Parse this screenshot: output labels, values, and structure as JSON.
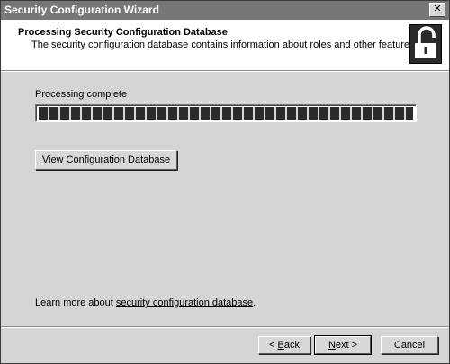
{
  "window": {
    "title": "Security Configuration Wizard",
    "close_glyph": "✕"
  },
  "header": {
    "title": "Processing Security Configuration Database",
    "subtitle": "The security configuration database contains information about roles and other features."
  },
  "progress": {
    "label": "Processing complete",
    "percent": 100
  },
  "view_button": {
    "mnemonic": "V",
    "rest": "iew Configuration Database"
  },
  "learn_more": {
    "prefix": "Learn more about ",
    "link": "security configuration database",
    "suffix": "."
  },
  "nav": {
    "back": {
      "prefix": "< ",
      "mnemonic": "B",
      "rest": "ack"
    },
    "next": {
      "prefix": "",
      "mnemonic": "N",
      "rest": "ext >"
    },
    "cancel": "Cancel"
  },
  "icons": {
    "header_icon": "open-padlock-icon"
  }
}
